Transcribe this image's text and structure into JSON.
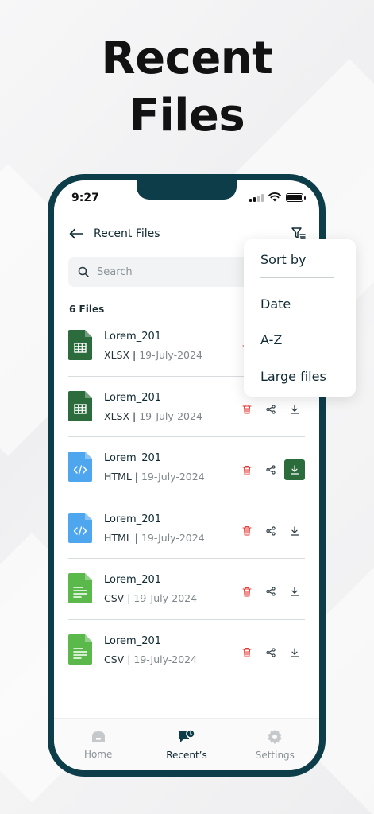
{
  "headline": {
    "line1": "Recent",
    "line2": "Files"
  },
  "status_bar": {
    "time": "9:27"
  },
  "app_bar": {
    "title": "Recent Files"
  },
  "search": {
    "placeholder": "Search"
  },
  "files_count": "6 Files",
  "files": [
    {
      "name": "Lorem_201",
      "type": "XLSX",
      "separator": " | ",
      "date": "19-July-2024",
      "icon": "spreadsheet-icon",
      "color": "#2b6b3c"
    },
    {
      "name": "Lorem_201",
      "type": "XLSX",
      "separator": " | ",
      "date": "19-July-2024",
      "icon": "spreadsheet-icon",
      "color": "#2b6b3c"
    },
    {
      "name": "Lorem_201",
      "type": "HTML",
      "separator": " | ",
      "date": "19-July-2024",
      "icon": "code-file-icon",
      "color": "#4da6ee"
    },
    {
      "name": "Lorem_201",
      "type": "HTML",
      "separator": " | ",
      "date": "19-July-2024",
      "icon": "code-file-icon",
      "color": "#4da6ee"
    },
    {
      "name": "Lorem_201",
      "type": "CSV",
      "separator": " | ",
      "date": "19-July-2024",
      "icon": "csv-file-icon",
      "color": "#5bb84a"
    },
    {
      "name": "Lorem_201",
      "type": "CSV",
      "separator": " | ",
      "date": "19-July-2024",
      "icon": "csv-file-icon",
      "color": "#5bb84a"
    }
  ],
  "sort_menu": {
    "title": "Sort by",
    "options": [
      "Date",
      "A-Z",
      "Large files"
    ]
  },
  "bottom_nav": {
    "items": [
      {
        "label": "Home",
        "icon": "home-icon"
      },
      {
        "label": "Recent’s",
        "icon": "recent-icon"
      },
      {
        "label": "Settings",
        "icon": "gear-icon"
      }
    ],
    "active": "Recent’s"
  },
  "colors": {
    "frame": "#0e3d4a",
    "accent_green": "#2b6b3c",
    "delete_red": "#e53935",
    "text_dark": "#0f2a33"
  }
}
